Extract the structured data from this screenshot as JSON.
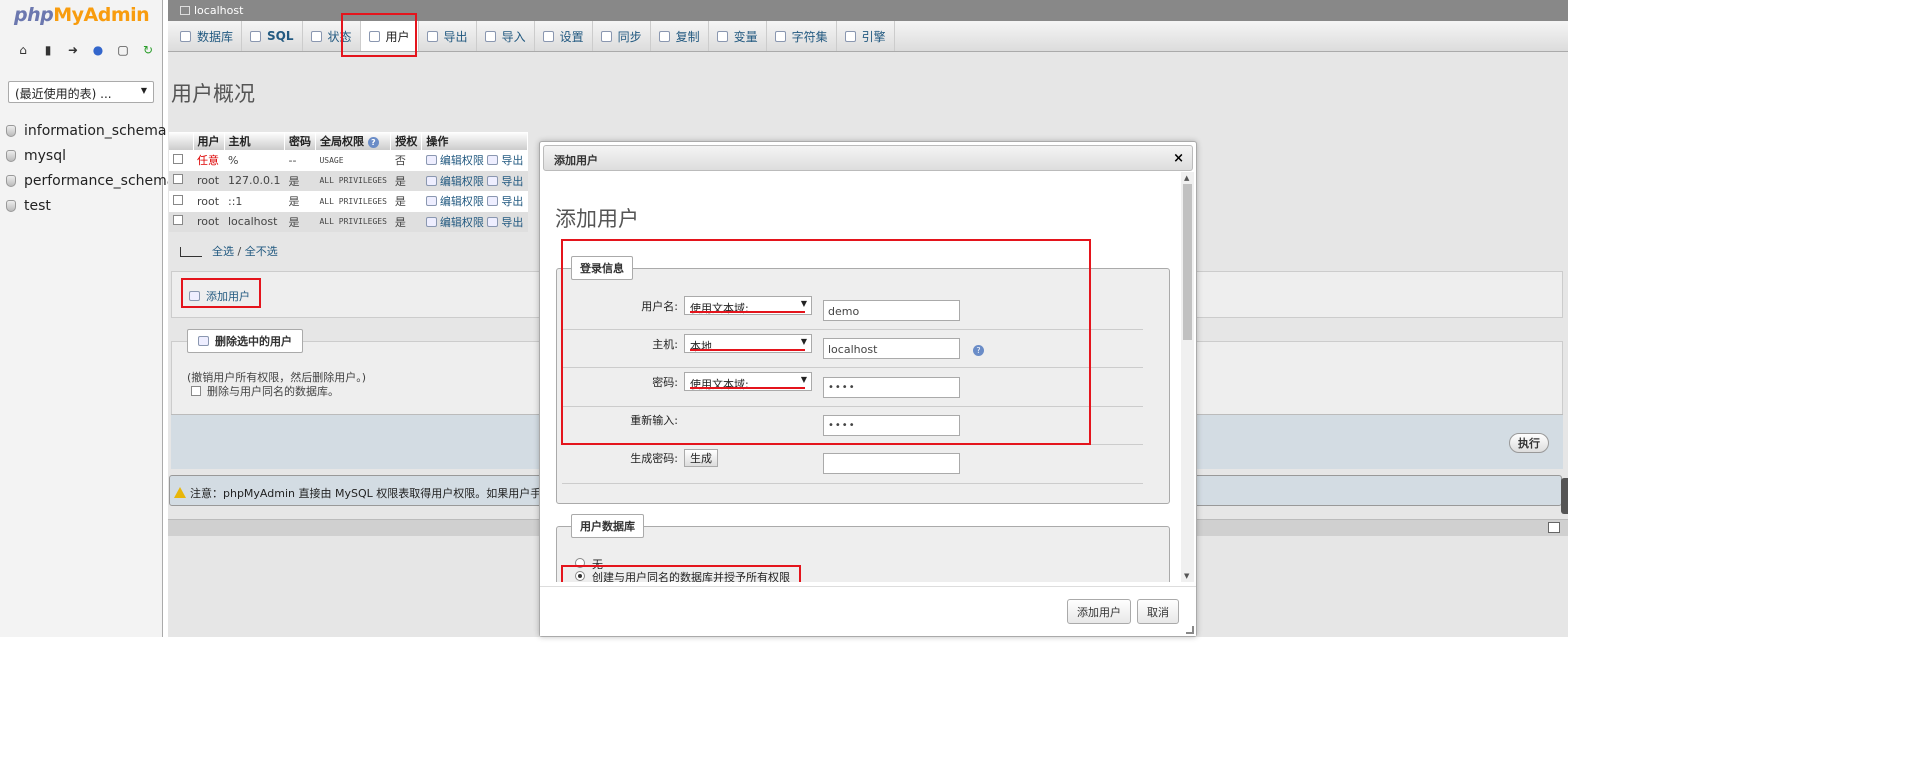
{
  "logo": {
    "php": "php",
    "my": "My",
    "admin": "Admin"
  },
  "nav": {
    "recent_select": "(最近使用的表) ...",
    "databases": [
      "information_schema",
      "mysql",
      "performance_schema",
      "test"
    ]
  },
  "breadcrumb": "localhost",
  "tabs": [
    "数据库",
    "SQL",
    "状态",
    "用户",
    "导出",
    "导入",
    "设置",
    "同步",
    "复制",
    "变量",
    "字符集",
    "引擎"
  ],
  "active_tab": "用户",
  "page_title": "用户概况",
  "user_table": {
    "headers": [
      "用户",
      "主机",
      "密码",
      "全局权限",
      "授权",
      "操作"
    ],
    "rows": [
      {
        "user": "任意",
        "host": "%",
        "password": "--",
        "privs": "USAGE",
        "grant": "否",
        "edit": "编辑权限",
        "export": "导出"
      },
      {
        "user": "root",
        "host": "127.0.0.1",
        "password": "是",
        "privs": "ALL PRIVILEGES",
        "grant": "是",
        "edit": "编辑权限",
        "export": "导出"
      },
      {
        "user": "root",
        "host": "::1",
        "password": "是",
        "privs": "ALL PRIVILEGES",
        "grant": "是",
        "edit": "编辑权限",
        "export": "导出"
      },
      {
        "user": "root",
        "host": "localhost",
        "password": "是",
        "privs": "ALL PRIVILEGES",
        "grant": "是",
        "edit": "编辑权限",
        "export": "导出"
      }
    ]
  },
  "select_all": "全选",
  "select_sep": "/",
  "select_none": "全不选",
  "add_user_link": "添加用户",
  "delete_panel": {
    "legend": "删除选中的用户",
    "note": "(撤销用户所有权限，然后删除用户。)",
    "drop_db_label": "删除与用户同名的数据库。",
    "exec": "执行"
  },
  "notice": "注意：phpMyAdmin 直接由 MySQL 权限表取得用户权限。如果用户手动",
  "dialog": {
    "title": "添加用户",
    "close": "×",
    "heading": "添加用户",
    "login_legend": "登录信息",
    "username_label": "用户名:",
    "username_select": "使用文本域:",
    "username_value": "demo",
    "host_label": "主机:",
    "host_select": "本地",
    "host_value": "localhost",
    "password_label": "密码:",
    "password_select": "使用文本域:",
    "password_value": "••••",
    "retype_label": "重新输入:",
    "retype_value": "••••",
    "generate_label": "生成密码:",
    "generate_button": "生成",
    "userdb_legend": "用户数据库",
    "radio_none": "无",
    "radio_create": "创建与用户同名的数据库并授予所有权限",
    "add_button": "添加用户",
    "cancel_button": "取消"
  },
  "colors": {
    "accent_red": "#e4141c",
    "link": "#235a81"
  }
}
